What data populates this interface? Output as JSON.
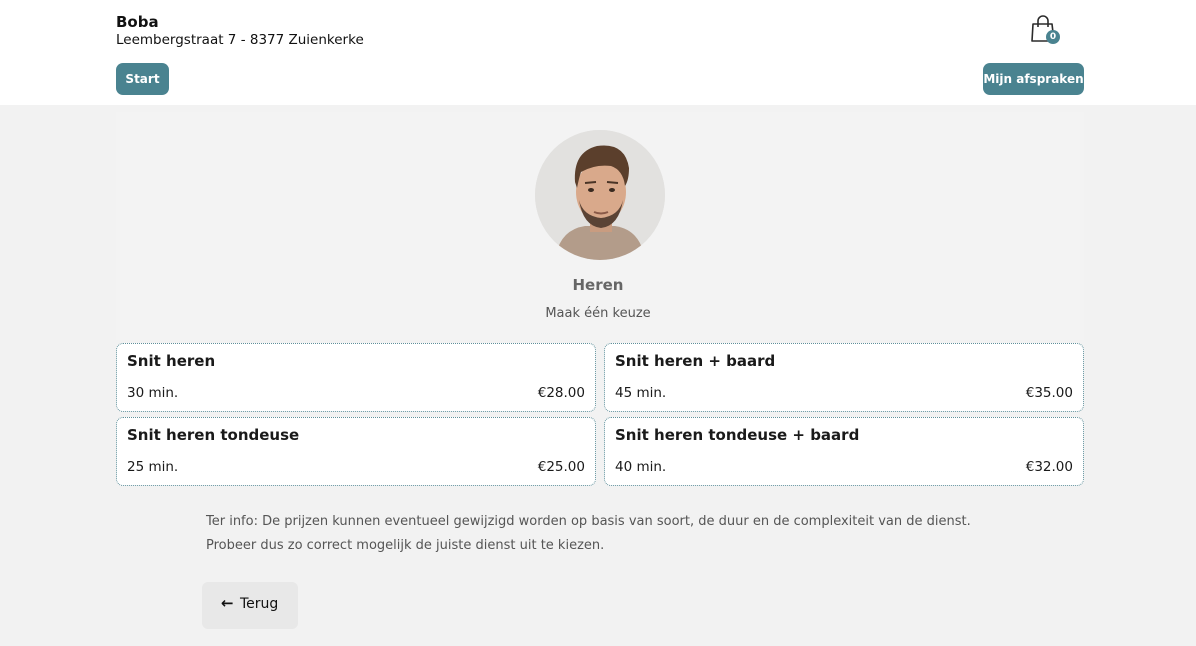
{
  "header": {
    "shop_name": "Boba",
    "address": "Leembergstraat 7 - 8377 Zuienkerke",
    "cart_count": "0",
    "start_label": "Start",
    "appointments_label": "Mijn afspraken",
    "accent_color": "#4a8390"
  },
  "category": {
    "title": "Heren",
    "subtitle": "Maak één keuze"
  },
  "services": [
    {
      "name": "Snit heren",
      "duration": "30 min.",
      "price": "€28.00"
    },
    {
      "name": "Snit heren + baard",
      "duration": "45 min.",
      "price": "€35.00"
    },
    {
      "name": "Snit heren tondeuse",
      "duration": "25 min.",
      "price": "€25.00"
    },
    {
      "name": "Snit heren tondeuse + baard",
      "duration": "40 min.",
      "price": "€32.00"
    }
  ],
  "info_text": "Ter info: De prijzen kunnen eventueel gewijzigd worden op basis van soort, de duur en de complexiteit van de dienst. Probeer dus zo correct mogelijk de juiste dienst uit te kiezen.",
  "back_button": {
    "icon": "arrow-left-icon",
    "label": "Terug"
  }
}
